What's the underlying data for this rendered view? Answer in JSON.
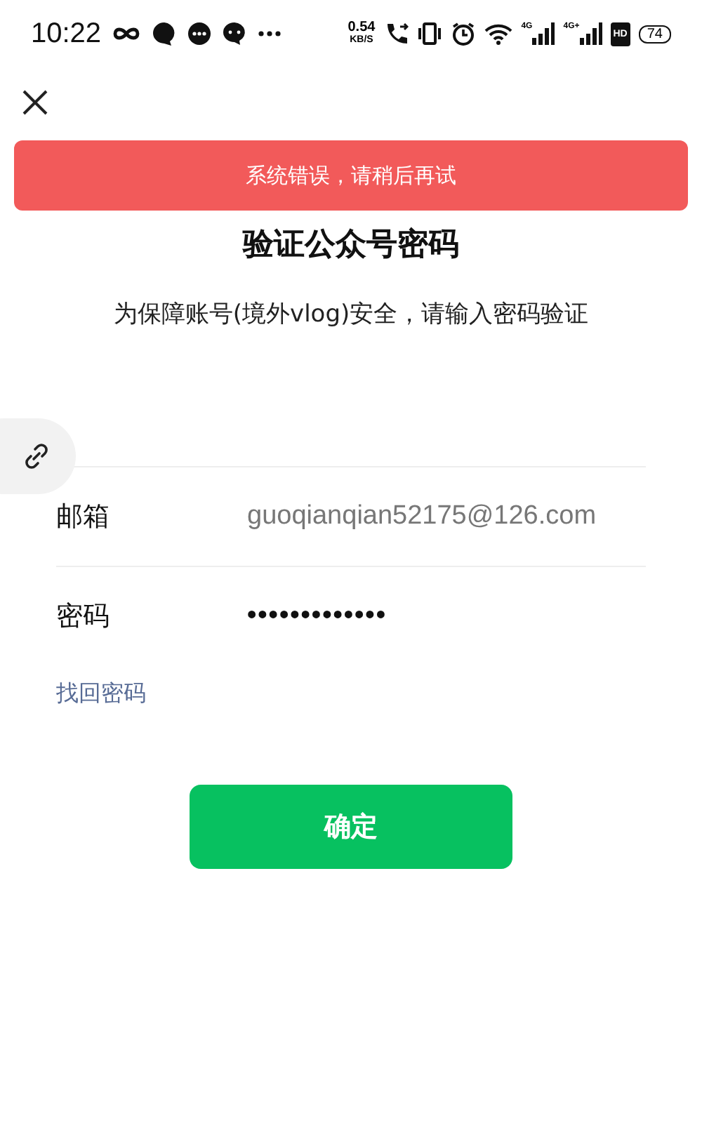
{
  "status_bar": {
    "time": "10:22",
    "speed": "0.54",
    "speed_unit": "KB/S",
    "sim_1": "4G",
    "sim_2": "4G+",
    "hd": "HD",
    "battery": "74"
  },
  "toast": {
    "text": "系统错误，请稍后再试"
  },
  "title": "验证公众号密码",
  "subtitle": "为保障账号(境外vlog)安全，请输入密码验证",
  "fields": [
    {
      "label": "邮箱",
      "value": "guoqianqian52175@126.com",
      "kind": "text"
    },
    {
      "label": "密码",
      "value": "•••••••••••••",
      "kind": "password"
    }
  ],
  "forgot_link": "找回密码",
  "confirm_button": "确定"
}
